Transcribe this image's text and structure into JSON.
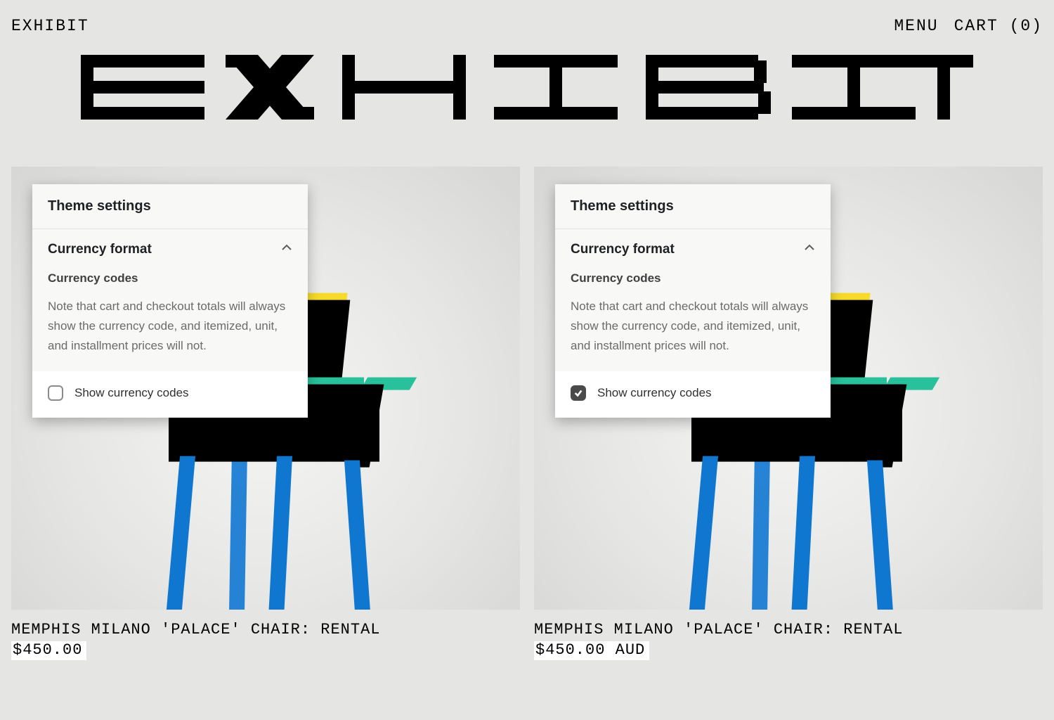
{
  "header": {
    "brand": "EXHIBIT",
    "menu": "MENU",
    "cart_label": "CART (0)"
  },
  "wordmark": "EXHIBIT",
  "settings": {
    "title": "Theme settings",
    "section": "Currency format",
    "subheading": "Currency codes",
    "note": "Note that cart and checkout totals will always show the currency code, and itemized, unit, and installment prices will not.",
    "checkbox_label": "Show currency codes"
  },
  "products": [
    {
      "title": "MEMPHIS MILANO 'PALACE' CHAIR: RENTAL",
      "price": "$450.00",
      "show_codes_checked": false
    },
    {
      "title": "MEMPHIS MILANO 'PALACE' CHAIR: RENTAL",
      "price": "$450.00 AUD",
      "show_codes_checked": true
    }
  ]
}
